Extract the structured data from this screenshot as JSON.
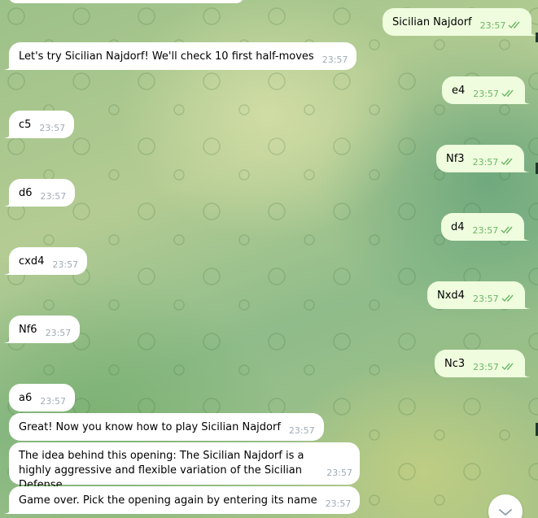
{
  "chat": {
    "messages": [
      {
        "dir": "out",
        "text": "Sicilian Najdorf",
        "time": "23:57"
      },
      {
        "dir": "in",
        "text": "Let's try Sicilian Najdorf! We'll check 10 first half-moves",
        "time": "23:57"
      },
      {
        "dir": "out",
        "text": "e4",
        "time": "23:57"
      },
      {
        "dir": "in",
        "text": "c5",
        "time": "23:57"
      },
      {
        "dir": "out",
        "text": "Nf3",
        "time": "23:57"
      },
      {
        "dir": "in",
        "text": "d6",
        "time": "23:57"
      },
      {
        "dir": "out",
        "text": "d4",
        "time": "23:57"
      },
      {
        "dir": "in",
        "text": "cxd4",
        "time": "23:57"
      },
      {
        "dir": "out",
        "text": "Nxd4",
        "time": "23:57"
      },
      {
        "dir": "in",
        "text": "Nf6",
        "time": "23:57"
      },
      {
        "dir": "out",
        "text": "Nc3",
        "time": "23:57"
      },
      {
        "dir": "in",
        "text": "a6",
        "time": "23:57"
      },
      {
        "dir": "in",
        "text": "Great! Now you know how to play Sicilian Najdorf",
        "time": "23:57"
      },
      {
        "dir": "in",
        "text": "The idea behind this opening: The Sicilian Najdorf is a highly aggressive and flexible variation of the Sicilian Defense.",
        "time": "23:57"
      },
      {
        "dir": "in",
        "text": "Game over. Pick the opening again by entering its name",
        "time": "23:57"
      }
    ]
  },
  "icons": {
    "read_status": "double-check-icon",
    "scroll_down": "chevron-down-icon"
  },
  "colors": {
    "outgoing_bubble": "#effdde",
    "incoming_bubble": "#ffffff",
    "check_color": "#6db567"
  }
}
